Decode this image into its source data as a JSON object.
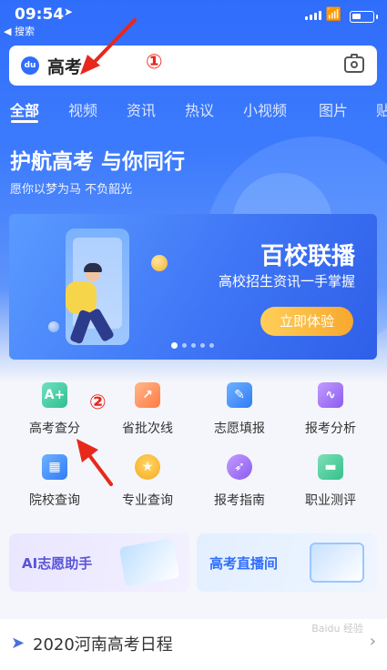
{
  "status": {
    "time": "09:54",
    "back_app": "◀ 搜索"
  },
  "search": {
    "query": "高考"
  },
  "annotations": {
    "one": "①",
    "two": "②"
  },
  "tabs": [
    "全部",
    "视频",
    "资讯",
    "热议",
    "小视频",
    "图片",
    "贴"
  ],
  "slogan": {
    "title": "护航高考 与你同行",
    "subtitle": "愿你以梦为马 不负韶光"
  },
  "banner": {
    "title": "百校联播",
    "subtitle": "高校招生资讯一手掌握",
    "button": "立即体验",
    "dot_count": 5,
    "active_dot": 0
  },
  "grid": [
    {
      "label": "高考查分",
      "icon": "score-icon",
      "color": "green"
    },
    {
      "label": "省批次线",
      "icon": "trend-icon",
      "color": "orange"
    },
    {
      "label": "志愿填报",
      "icon": "edit-icon",
      "color": "blue"
    },
    {
      "label": "报考分析",
      "icon": "chart-icon",
      "color": "purple"
    },
    {
      "label": "院校查询",
      "icon": "building-icon",
      "color": "blue"
    },
    {
      "label": "专业查询",
      "icon": "medal-icon",
      "color": "yellow"
    },
    {
      "label": "报考指南",
      "icon": "compass-icon",
      "color": "purple"
    },
    {
      "label": "职业测评",
      "icon": "briefcase-icon",
      "color": "teal"
    }
  ],
  "cards": {
    "ai": "AI志愿助手",
    "live": "高考直播间"
  },
  "schedule": {
    "title": "2020河南高考日程"
  },
  "watermark": "Baidu 经验"
}
